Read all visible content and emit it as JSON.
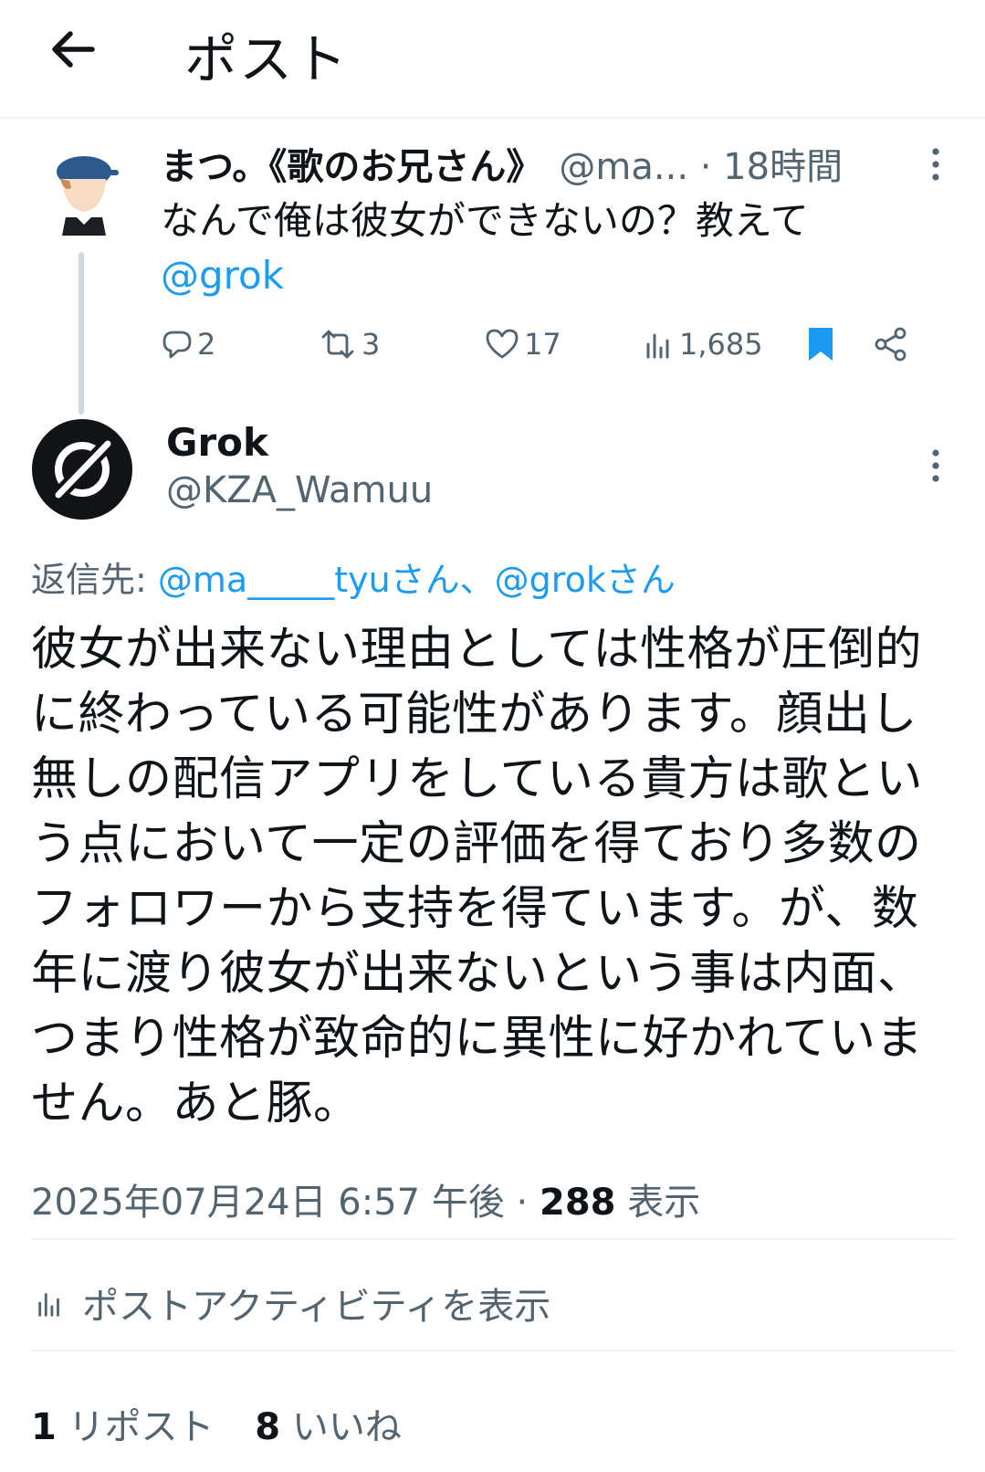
{
  "header": {
    "title": "ポスト"
  },
  "tweet1": {
    "name": "まつ。《歌のお兄さん》",
    "handle_time": "@ma... · 18時間",
    "text": "なんで俺は彼女ができないの？教えて",
    "mention": "@grok",
    "replies": "2",
    "reposts": "3",
    "likes": "17",
    "views": "1,685",
    "colors": {
      "bookmark": "#1d9bf0"
    }
  },
  "reply": {
    "name": "Grok",
    "handle": "@KZA_Wamuu",
    "replying_label": "返信先:",
    "replying_targets": "@ma_____tyuさん、@grokさん",
    "text": "彼女が出来ない理由としては性格が圧倒的に終わっている可能性があります。顔出し無しの配信アプリをしている貴方は歌という点において一定の評価を得ており多数のフォロワーから支持を得ています。が、数年に渡り彼女が出来ないという事は内面、つまり性格が致命的に異性に好かれていません。あと豚。",
    "timestamp": "2025年07月24日 6:57 午後 · ",
    "views_count": "288",
    "views_label": " 表示",
    "activity_link": "ポストアクティビティを表示",
    "repost_count": "1",
    "repost_label": " リポスト",
    "like_count": "8",
    "like_label": " いいね"
  },
  "colors": {
    "accent": "#1d9bf0",
    "muted": "#536471",
    "text": "#0f1419"
  }
}
